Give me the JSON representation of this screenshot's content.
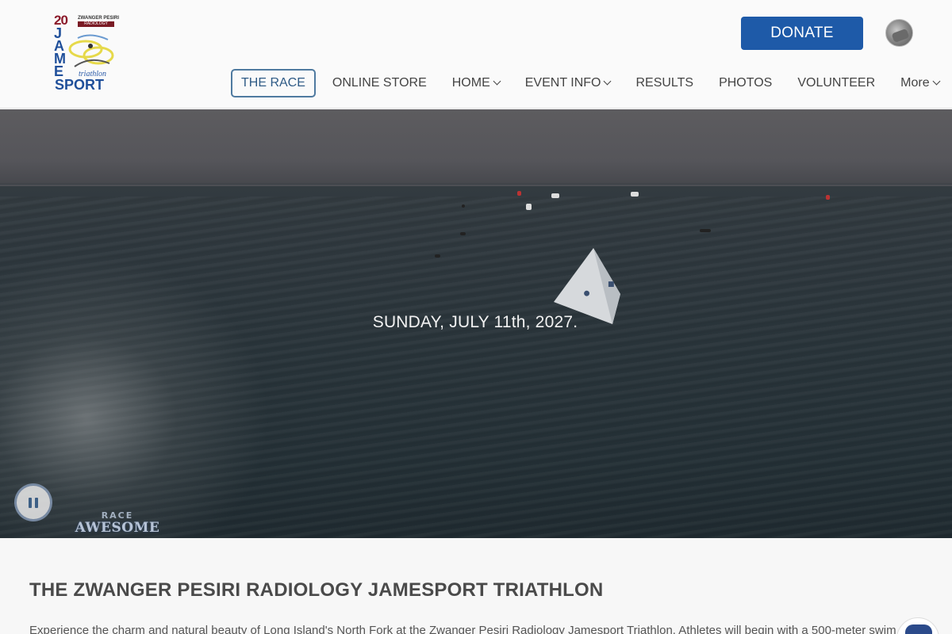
{
  "logo": {
    "anniversary": "20",
    "brand_line1": "ZWANGER PESIRI",
    "brand_line2": "RADIOLOGY",
    "word_jame": "JAME",
    "word_sport": "SPORT",
    "word_triathlon": "triathlon"
  },
  "header": {
    "donate_label": "DONATE"
  },
  "nav": {
    "items": [
      {
        "label": "THE RACE",
        "active": true,
        "dropdown": false
      },
      {
        "label": "ONLINE STORE",
        "active": false,
        "dropdown": false
      },
      {
        "label": "HOME",
        "active": false,
        "dropdown": true
      },
      {
        "label": "EVENT INFO",
        "active": false,
        "dropdown": true
      },
      {
        "label": "RESULTS",
        "active": false,
        "dropdown": false
      },
      {
        "label": "PHOTOS",
        "active": false,
        "dropdown": false
      },
      {
        "label": "VOLUNTEER",
        "active": false,
        "dropdown": false
      },
      {
        "label": "More",
        "active": false,
        "dropdown": true
      }
    ]
  },
  "hero": {
    "date_text": "SUNDAY, JULY 11th, 2027.",
    "watermark_top": "RACE",
    "watermark_main": "AWESOME"
  },
  "content": {
    "title": "THE ZWANGER PESIRI RADIOLOGY JAMESPORT TRIATHLON",
    "intro": "Experience the charm and natural beauty of Long Island's North Fork at the Zwanger Pesiri Radiology Jamesport Triathlon. Athletes will begin with a 500-meter swim"
  },
  "colors": {
    "accent": "#1e5aa8",
    "active_nav_border": "#4f7aa0",
    "heading": "#4a4a4a"
  },
  "icons": {
    "pause": "pause-icon",
    "chevron": "chevron-down-icon"
  }
}
